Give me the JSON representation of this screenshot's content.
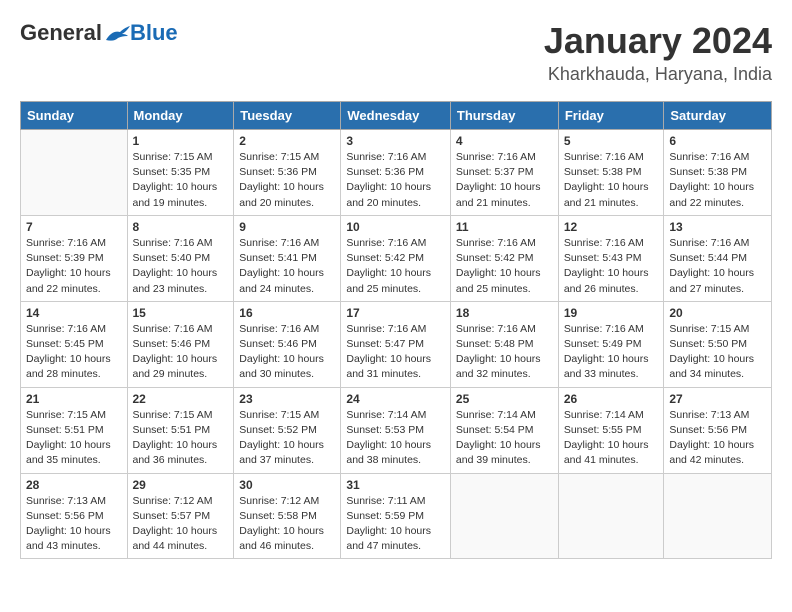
{
  "header": {
    "logo_general": "General",
    "logo_blue": "Blue",
    "main_title": "January 2024",
    "subtitle": "Kharkhauda, Haryana, India"
  },
  "days_of_week": [
    "Sunday",
    "Monday",
    "Tuesday",
    "Wednesday",
    "Thursday",
    "Friday",
    "Saturday"
  ],
  "weeks": [
    [
      {
        "day": "",
        "info": ""
      },
      {
        "day": "1",
        "info": "Sunrise: 7:15 AM\nSunset: 5:35 PM\nDaylight: 10 hours\nand 19 minutes."
      },
      {
        "day": "2",
        "info": "Sunrise: 7:15 AM\nSunset: 5:36 PM\nDaylight: 10 hours\nand 20 minutes."
      },
      {
        "day": "3",
        "info": "Sunrise: 7:16 AM\nSunset: 5:36 PM\nDaylight: 10 hours\nand 20 minutes."
      },
      {
        "day": "4",
        "info": "Sunrise: 7:16 AM\nSunset: 5:37 PM\nDaylight: 10 hours\nand 21 minutes."
      },
      {
        "day": "5",
        "info": "Sunrise: 7:16 AM\nSunset: 5:38 PM\nDaylight: 10 hours\nand 21 minutes."
      },
      {
        "day": "6",
        "info": "Sunrise: 7:16 AM\nSunset: 5:38 PM\nDaylight: 10 hours\nand 22 minutes."
      }
    ],
    [
      {
        "day": "7",
        "info": "Sunrise: 7:16 AM\nSunset: 5:39 PM\nDaylight: 10 hours\nand 22 minutes."
      },
      {
        "day": "8",
        "info": "Sunrise: 7:16 AM\nSunset: 5:40 PM\nDaylight: 10 hours\nand 23 minutes."
      },
      {
        "day": "9",
        "info": "Sunrise: 7:16 AM\nSunset: 5:41 PM\nDaylight: 10 hours\nand 24 minutes."
      },
      {
        "day": "10",
        "info": "Sunrise: 7:16 AM\nSunset: 5:42 PM\nDaylight: 10 hours\nand 25 minutes."
      },
      {
        "day": "11",
        "info": "Sunrise: 7:16 AM\nSunset: 5:42 PM\nDaylight: 10 hours\nand 25 minutes."
      },
      {
        "day": "12",
        "info": "Sunrise: 7:16 AM\nSunset: 5:43 PM\nDaylight: 10 hours\nand 26 minutes."
      },
      {
        "day": "13",
        "info": "Sunrise: 7:16 AM\nSunset: 5:44 PM\nDaylight: 10 hours\nand 27 minutes."
      }
    ],
    [
      {
        "day": "14",
        "info": "Sunrise: 7:16 AM\nSunset: 5:45 PM\nDaylight: 10 hours\nand 28 minutes."
      },
      {
        "day": "15",
        "info": "Sunrise: 7:16 AM\nSunset: 5:46 PM\nDaylight: 10 hours\nand 29 minutes."
      },
      {
        "day": "16",
        "info": "Sunrise: 7:16 AM\nSunset: 5:46 PM\nDaylight: 10 hours\nand 30 minutes."
      },
      {
        "day": "17",
        "info": "Sunrise: 7:16 AM\nSunset: 5:47 PM\nDaylight: 10 hours\nand 31 minutes."
      },
      {
        "day": "18",
        "info": "Sunrise: 7:16 AM\nSunset: 5:48 PM\nDaylight: 10 hours\nand 32 minutes."
      },
      {
        "day": "19",
        "info": "Sunrise: 7:16 AM\nSunset: 5:49 PM\nDaylight: 10 hours\nand 33 minutes."
      },
      {
        "day": "20",
        "info": "Sunrise: 7:15 AM\nSunset: 5:50 PM\nDaylight: 10 hours\nand 34 minutes."
      }
    ],
    [
      {
        "day": "21",
        "info": "Sunrise: 7:15 AM\nSunset: 5:51 PM\nDaylight: 10 hours\nand 35 minutes."
      },
      {
        "day": "22",
        "info": "Sunrise: 7:15 AM\nSunset: 5:51 PM\nDaylight: 10 hours\nand 36 minutes."
      },
      {
        "day": "23",
        "info": "Sunrise: 7:15 AM\nSunset: 5:52 PM\nDaylight: 10 hours\nand 37 minutes."
      },
      {
        "day": "24",
        "info": "Sunrise: 7:14 AM\nSunset: 5:53 PM\nDaylight: 10 hours\nand 38 minutes."
      },
      {
        "day": "25",
        "info": "Sunrise: 7:14 AM\nSunset: 5:54 PM\nDaylight: 10 hours\nand 39 minutes."
      },
      {
        "day": "26",
        "info": "Sunrise: 7:14 AM\nSunset: 5:55 PM\nDaylight: 10 hours\nand 41 minutes."
      },
      {
        "day": "27",
        "info": "Sunrise: 7:13 AM\nSunset: 5:56 PM\nDaylight: 10 hours\nand 42 minutes."
      }
    ],
    [
      {
        "day": "28",
        "info": "Sunrise: 7:13 AM\nSunset: 5:56 PM\nDaylight: 10 hours\nand 43 minutes."
      },
      {
        "day": "29",
        "info": "Sunrise: 7:12 AM\nSunset: 5:57 PM\nDaylight: 10 hours\nand 44 minutes."
      },
      {
        "day": "30",
        "info": "Sunrise: 7:12 AM\nSunset: 5:58 PM\nDaylight: 10 hours\nand 46 minutes."
      },
      {
        "day": "31",
        "info": "Sunrise: 7:11 AM\nSunset: 5:59 PM\nDaylight: 10 hours\nand 47 minutes."
      },
      {
        "day": "",
        "info": ""
      },
      {
        "day": "",
        "info": ""
      },
      {
        "day": "",
        "info": ""
      }
    ]
  ]
}
